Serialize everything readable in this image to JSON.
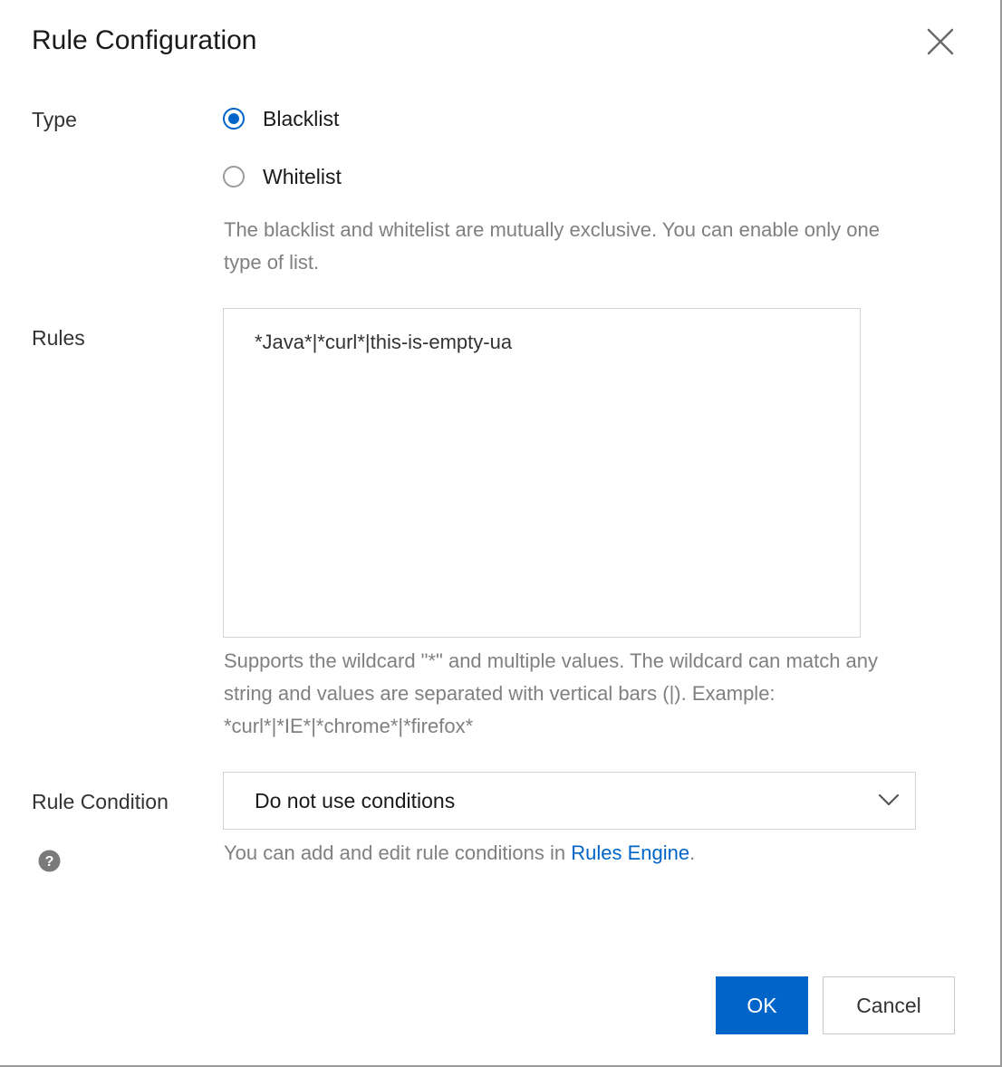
{
  "dialog": {
    "title": "Rule Configuration",
    "close_icon": "close-icon"
  },
  "type": {
    "label": "Type",
    "options": [
      {
        "label": "Blacklist",
        "checked": true
      },
      {
        "label": "Whitelist",
        "checked": false
      }
    ],
    "help": "The blacklist and whitelist are mutually exclusive. You can enable only one type of list."
  },
  "rules": {
    "label": "Rules",
    "value": "*Java*|*curl*|this-is-empty-ua",
    "help": "Supports the wildcard \"*\" and multiple values. The wildcard can match any string and values are separated with vertical bars (|). Example: *curl*|*IE*|*chrome*|*firefox*"
  },
  "condition": {
    "label": "Rule Condition",
    "selected": "Do not use conditions",
    "help_prefix": "You can add and edit rule conditions in ",
    "help_link": "Rules Engine",
    "help_suffix": ".",
    "help_icon": "question-icon"
  },
  "footer": {
    "ok_label": "OK",
    "cancel_label": "Cancel"
  },
  "colors": {
    "primary": "#0064c8",
    "help_text": "#808080",
    "border": "#d4d4d4"
  }
}
